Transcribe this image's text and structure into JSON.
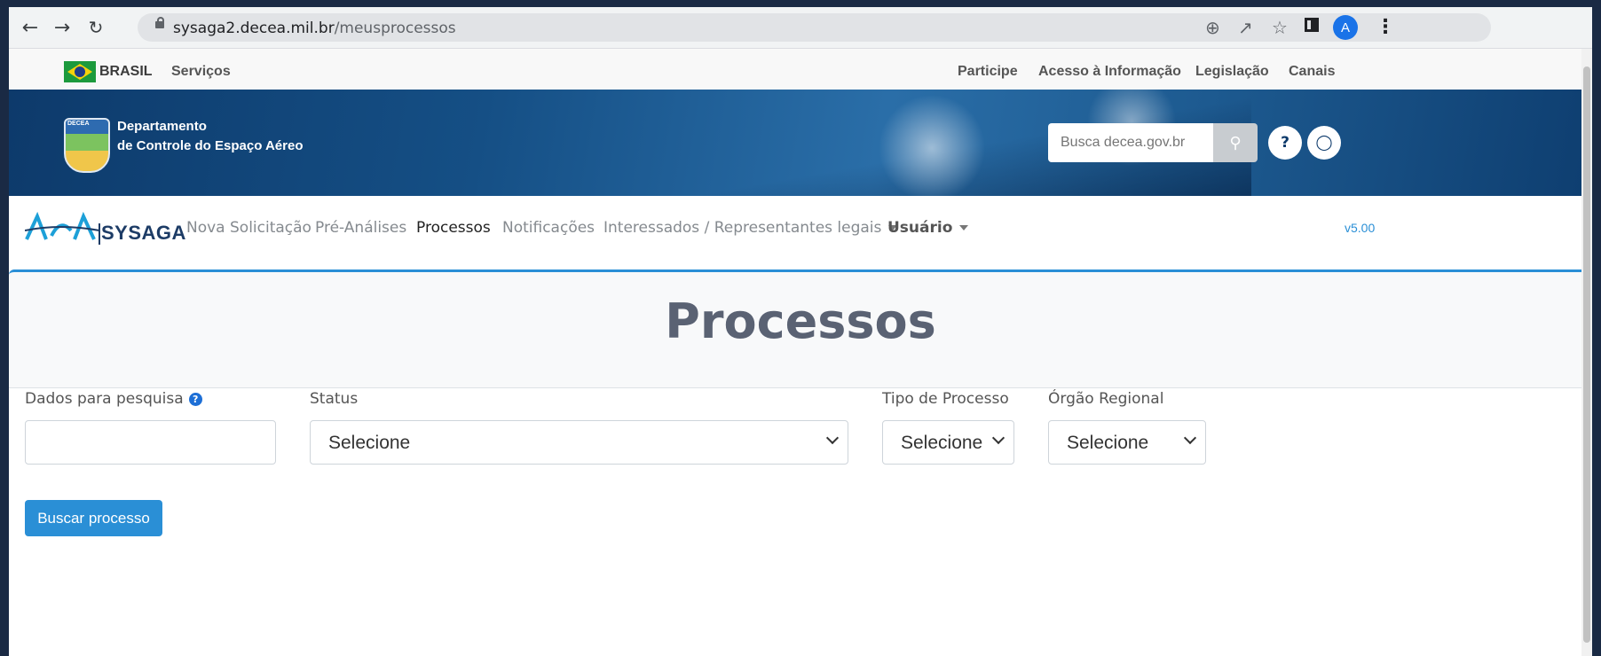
{
  "browser": {
    "url_host": "sysaga2.decea.mil.br",
    "url_path": "/meusprocessos",
    "profile_initial": "A"
  },
  "govbar": {
    "country": "BRASIL",
    "services": "Serviços",
    "links": [
      "Participe",
      "Acesso à Informação",
      "Legislação",
      "Canais"
    ]
  },
  "banner": {
    "dept_line1": "Departamento",
    "dept_line2": "de Controle do Espaço Aéreo",
    "emblem_text": "DECEA",
    "search_placeholder": "Busca decea.gov.br"
  },
  "appnav": {
    "logo_text": "SYSAGA",
    "items": [
      "Nova Solicitação",
      "Pré-Análises",
      "Processos",
      "Notificações",
      "Interessados / Representantes legais",
      "Usuário"
    ],
    "active": "Processos",
    "version": "v5.00"
  },
  "page": {
    "title": "Processos"
  },
  "form": {
    "search_label": "Dados para pesquisa",
    "search_value": "",
    "status_label": "Status",
    "status_value": "Selecione",
    "tipo_label": "Tipo de Processo",
    "tipo_value": "Selecione",
    "orgao_label": "Órgão Regional",
    "orgao_value": "Selecione",
    "submit_label": "Buscar processo"
  },
  "colors": {
    "accent": "#2a8fd6",
    "banner": "#154f85",
    "title": "#5a6273"
  }
}
